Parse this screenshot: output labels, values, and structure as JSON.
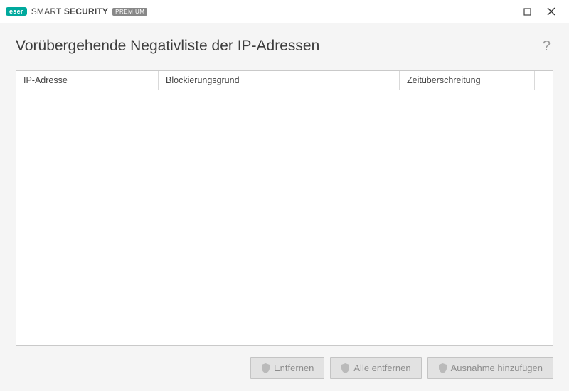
{
  "titlebar": {
    "brand_badge": "eser",
    "brand_text_light": "SMART",
    "brand_text_bold": "SECURITY",
    "tier": "PREMIUM"
  },
  "page": {
    "title": "Vorübergehende Negativliste der IP-Adressen",
    "help_symbol": "?"
  },
  "table": {
    "columns": {
      "ip": "IP-Adresse",
      "reason": "Blockierungsgrund",
      "timeout": "Zeitüberschreitung"
    },
    "rows": []
  },
  "buttons": {
    "remove": "Entfernen",
    "remove_all": "Alle entfernen",
    "add_exception": "Ausnahme hinzufügen"
  }
}
